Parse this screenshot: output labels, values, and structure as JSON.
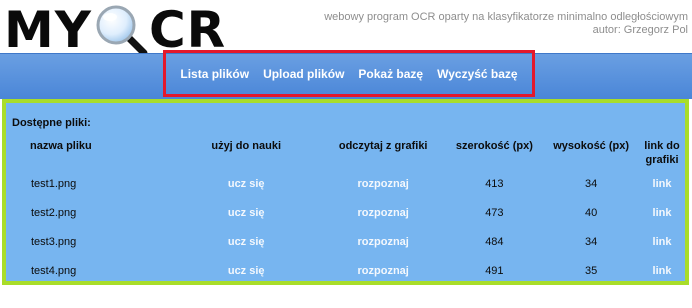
{
  "header": {
    "logo_left": "MY",
    "logo_right": "CR",
    "logo_icon": "magnifier-icon",
    "tagline": "webowy program OCR oparty na klasyfikatorze minimalno odległościowym",
    "author": "autor: Grzegorz Pol"
  },
  "nav": {
    "items": [
      {
        "label": "Lista plików"
      },
      {
        "label": "Upload plików"
      },
      {
        "label": "Pokaż bazę"
      },
      {
        "label": "Wyczyść bazę"
      }
    ]
  },
  "files": {
    "title": "Dostępne pliki:",
    "columns": [
      {
        "label": "nazwa pliku"
      },
      {
        "label": "użyj do nauki"
      },
      {
        "label": "odczytaj z grafiki"
      },
      {
        "label": "szerokość (px)"
      },
      {
        "label": "wysokość (px)"
      },
      {
        "label": "link do grafiki"
      }
    ],
    "rows": [
      {
        "name": "test1.png",
        "learn": "ucz się",
        "recognize": "rozpoznaj",
        "width": "413",
        "height": "34",
        "link": "link"
      },
      {
        "name": "test2.png",
        "learn": "ucz się",
        "recognize": "rozpoznaj",
        "width": "473",
        "height": "40",
        "link": "link"
      },
      {
        "name": "test3.png",
        "learn": "ucz się",
        "recognize": "rozpoznaj",
        "width": "484",
        "height": "34",
        "link": "link"
      },
      {
        "name": "test4.png",
        "learn": "ucz się",
        "recognize": "rozpoznaj",
        "width": "491",
        "height": "35",
        "link": "link"
      }
    ]
  },
  "colors": {
    "nav_highlight": "#e3182c",
    "content_highlight": "#a9dd2a",
    "content_bg": "#77b5f0",
    "navbar_bg": "#5a92dd"
  }
}
